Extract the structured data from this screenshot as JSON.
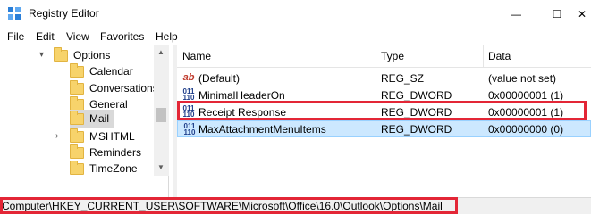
{
  "window": {
    "title": "Registry Editor",
    "minimize_glyph": "—",
    "maximize_glyph": "☐",
    "close_glyph": "✕"
  },
  "menu": [
    "File",
    "Edit",
    "View",
    "Favorites",
    "Help"
  ],
  "tree": {
    "items": [
      {
        "label": "Options",
        "expanded": true
      },
      {
        "label": "Calendar"
      },
      {
        "label": "Conversations"
      },
      {
        "label": "General"
      },
      {
        "label": "Mail",
        "selected": true
      },
      {
        "label": "MSHTML",
        "collapsed": true
      },
      {
        "label": "Reminders"
      },
      {
        "label": "TimeZone"
      }
    ]
  },
  "list": {
    "columns": [
      "Name",
      "Type",
      "Data"
    ],
    "rows": [
      {
        "icon": "string-value-icon",
        "glyph": "ab",
        "name": "(Default)",
        "type": "REG_SZ",
        "data": "(value not set)"
      },
      {
        "icon": "dword-value-icon",
        "glyph": "011\n110",
        "name": "MinimalHeaderOn",
        "type": "REG_DWORD",
        "data": "0x00000001 (1)"
      },
      {
        "icon": "dword-value-icon",
        "glyph": "011\n110",
        "name": "Receipt Response",
        "type": "REG_DWORD",
        "data": "0x00000001 (1)",
        "highlighted": true
      },
      {
        "icon": "dword-value-icon",
        "glyph": "011\n110",
        "name": "MaxAttachmentMenuItems",
        "type": "REG_DWORD",
        "data": "0x00000000 (0)",
        "selected": true
      }
    ]
  },
  "status": {
    "path": "Computer\\HKEY_CURRENT_USER\\SOFTWARE\\Microsoft\\Office\\16.0\\Outlook\\Options\\Mail"
  },
  "colors": {
    "highlight": "#e32636",
    "selection": "#cce8ff",
    "folder": "#f7d36b"
  }
}
